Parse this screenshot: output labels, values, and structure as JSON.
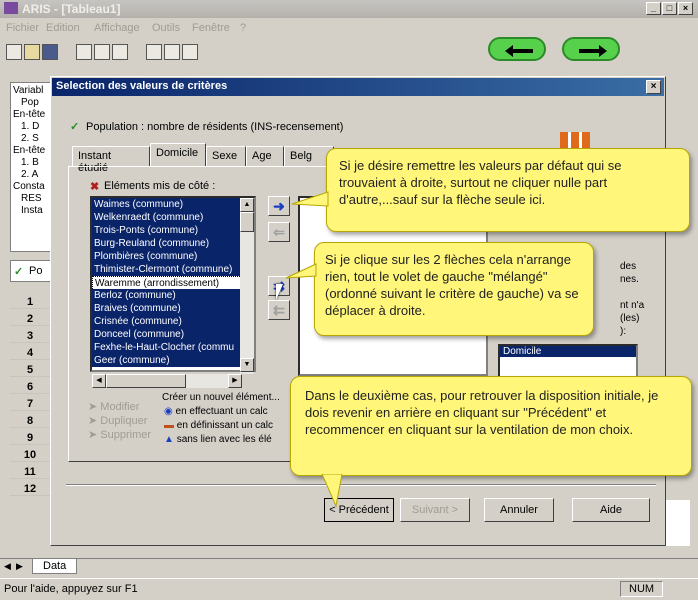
{
  "app": {
    "title": "ARIS - [Tableau1]"
  },
  "menu": [
    "Fichier",
    "Edition",
    "Affichage",
    "Outils",
    "Fenêtre",
    "?"
  ],
  "nav": {
    "back_icon": "arrow-left-icon",
    "forward_icon": "arrow-right-icon",
    "accent": "#57d14c"
  },
  "leftpane": {
    "lines": [
      "Variabl",
      "Pop",
      "En-tête",
      "1. D",
      "2. S",
      "En-tête",
      "1. B",
      "2. A",
      "Consta",
      "RES",
      "Insta"
    ]
  },
  "grid": {
    "tab_label": "Po",
    "rows": [
      "1",
      "2",
      "3",
      "4",
      "5",
      "6",
      "7",
      "8",
      "9",
      "10",
      "11",
      "12"
    ],
    "sheet_tab": "Data"
  },
  "dialog": {
    "title": "Selection des valeurs de critères",
    "population": "Population : nombre de résidents (INS-recensement)",
    "tabs": [
      "Instant étudié",
      "Domicile",
      "Sexe",
      "Age",
      "Belg"
    ],
    "list_label": "Eléments mis de côté :",
    "items": [
      {
        "text": "Waimes (commune)",
        "selected": true
      },
      {
        "text": "Welkenraedt (commune)",
        "selected": true
      },
      {
        "text": "Trois-Ponts (commune)",
        "selected": true
      },
      {
        "text": "Burg-Reuland (commune)",
        "selected": true
      },
      {
        "text": "Plombières (commune)",
        "selected": true
      },
      {
        "text": "Thimister-Clermont (commune)",
        "selected": true
      },
      {
        "text": "Waremme (arrondissement)",
        "selected": false
      },
      {
        "text": "Berloz (commune)",
        "selected": true
      },
      {
        "text": "Braives (commune)",
        "selected": true
      },
      {
        "text": "Crisnée (commune)",
        "selected": true
      },
      {
        "text": "Donceel (commune)",
        "selected": true
      },
      {
        "text": "Fexhe-le-Haut-Clocher (commu",
        "selected": true
      },
      {
        "text": "Geer (commune)",
        "selected": true
      }
    ],
    "right_text": [
      "des",
      "nes.",
      "nt n'a",
      "(les)",
      "):"
    ],
    "domicile_item": "Domicile",
    "actions": {
      "modifier": "Modifier",
      "dupliquer": "Dupliquer",
      "supprimer": "Supprimer",
      "create_title": "Créer un nouvel élément...",
      "create_1": "en effectuant un calc",
      "create_2": "en définissant un calc",
      "create_3": "sans lien avec les élé"
    },
    "buttons": {
      "prev": "< Précédent",
      "next": "Suivant >",
      "cancel": "Annuler",
      "help": "Aide"
    }
  },
  "bubbles": {
    "b1": "Si je désire remettre les valeurs par défaut qui se trouvaient à droite, surtout ne cliquer nulle part d'autre,...sauf sur la flèche seule ici.",
    "b2": "Si je clique sur les 2 flèches cela n'arrange rien, tout le volet de gauche \"mélangé\" (ordonné suivant le critère de gauche) va se déplacer à droite.",
    "b3": "Dans le deuxième cas, pour retrouver la disposition initiale, je dois revenir en arrière en cliquant sur \"Précédent\" et recommencer en cliquant sur la ventilation de mon choix."
  },
  "status": {
    "text": "Pour l'aide, appuyez sur F1",
    "num": "NUM"
  }
}
